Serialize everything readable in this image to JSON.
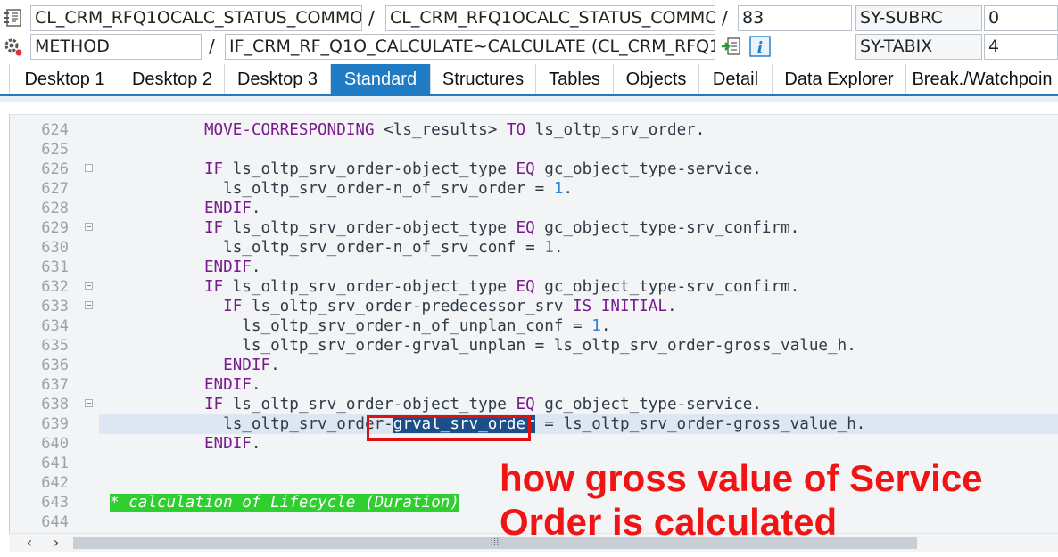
{
  "header": {
    "row1": {
      "program": "CL_CRM_RFQ1OCALC_STATUS_COMMO…",
      "include": "CL_CRM_RFQ1OCALC_STATUS_COMMO…",
      "line": "83",
      "sysfield_name": "SY-SUBRC",
      "sysfield_value": "0"
    },
    "row2": {
      "event_type": "METHOD",
      "event_name": "IF_CRM_RF_Q1O_CALCULATE~CALCULATE (CL_CRM_RFQ1…",
      "sysfield_name": "SY-TABIX",
      "sysfield_value": "4"
    },
    "separator": "/",
    "icons": [
      "source-code-icon",
      "settings-gear-icon",
      "navigate-icon",
      "info-icon"
    ]
  },
  "tabs": [
    {
      "label": "Desktop 1",
      "active": false
    },
    {
      "label": "Desktop 2",
      "active": false
    },
    {
      "label": "Desktop 3",
      "active": false
    },
    {
      "label": "Standard",
      "active": true
    },
    {
      "label": "Structures",
      "active": false
    },
    {
      "label": "Tables",
      "active": false
    },
    {
      "label": "Objects",
      "active": false
    },
    {
      "label": "Detail",
      "active": false
    },
    {
      "label": "Data Explorer",
      "active": false
    },
    {
      "label": "Break./Watchpoin",
      "active": false
    }
  ],
  "editor": {
    "current_line": "639",
    "lines": [
      {
        "num": "624",
        "fold": false,
        "parts": [
          [
            "",
            "          "
          ],
          [
            "kw",
            "MOVE-CORRESPONDING"
          ],
          [
            "",
            " <ls_results> "
          ],
          [
            "kw",
            "TO"
          ],
          [
            "",
            " ls_oltp_srv_order."
          ]
        ]
      },
      {
        "num": "625",
        "fold": false,
        "parts": []
      },
      {
        "num": "626",
        "fold": true,
        "parts": [
          [
            "",
            "          "
          ],
          [
            "kw",
            "IF"
          ],
          [
            "",
            " ls_oltp_srv_order-object_type "
          ],
          [
            "kw",
            "EQ"
          ],
          [
            "",
            " gc_object_type-service."
          ]
        ]
      },
      {
        "num": "627",
        "fold": false,
        "parts": [
          [
            "",
            "            ls_oltp_srv_order-n_of_srv_order = "
          ],
          [
            "num",
            "1"
          ],
          [
            "",
            "."
          ]
        ]
      },
      {
        "num": "628",
        "fold": false,
        "parts": [
          [
            "",
            "          "
          ],
          [
            "kw",
            "ENDIF"
          ],
          [
            "",
            "."
          ]
        ]
      },
      {
        "num": "629",
        "fold": true,
        "parts": [
          [
            "",
            "          "
          ],
          [
            "kw",
            "IF"
          ],
          [
            "",
            " ls_oltp_srv_order-object_type "
          ],
          [
            "kw",
            "EQ"
          ],
          [
            "",
            " gc_object_type-srv_confirm."
          ]
        ]
      },
      {
        "num": "630",
        "fold": false,
        "parts": [
          [
            "",
            "            ls_oltp_srv_order-n_of_srv_conf = "
          ],
          [
            "num",
            "1"
          ],
          [
            "",
            "."
          ]
        ]
      },
      {
        "num": "631",
        "fold": false,
        "parts": [
          [
            "",
            "          "
          ],
          [
            "kw",
            "ENDIF"
          ],
          [
            "",
            "."
          ]
        ]
      },
      {
        "num": "632",
        "fold": true,
        "parts": [
          [
            "",
            "          "
          ],
          [
            "kw",
            "IF"
          ],
          [
            "",
            " ls_oltp_srv_order-object_type "
          ],
          [
            "kw",
            "EQ"
          ],
          [
            "",
            " gc_object_type-srv_confirm."
          ]
        ]
      },
      {
        "num": "633",
        "fold": true,
        "parts": [
          [
            "",
            "            "
          ],
          [
            "kw",
            "IF"
          ],
          [
            "",
            " ls_oltp_srv_order-predecessor_srv "
          ],
          [
            "kw",
            "IS INITIAL"
          ],
          [
            "",
            "."
          ]
        ]
      },
      {
        "num": "634",
        "fold": false,
        "parts": [
          [
            "",
            "              ls_oltp_srv_order-n_of_unplan_conf = "
          ],
          [
            "num",
            "1"
          ],
          [
            "",
            "."
          ]
        ]
      },
      {
        "num": "635",
        "fold": false,
        "parts": [
          [
            "",
            "              ls_oltp_srv_order-grval_unplan = ls_oltp_srv_order-gross_value_h."
          ]
        ]
      },
      {
        "num": "636",
        "fold": false,
        "parts": [
          [
            "",
            "            "
          ],
          [
            "kw",
            "ENDIF"
          ],
          [
            "",
            "."
          ]
        ]
      },
      {
        "num": "637",
        "fold": false,
        "parts": [
          [
            "",
            "          "
          ],
          [
            "kw",
            "ENDIF"
          ],
          [
            "",
            "."
          ]
        ]
      },
      {
        "num": "638",
        "fold": true,
        "parts": [
          [
            "",
            "          "
          ],
          [
            "kw",
            "IF"
          ],
          [
            "",
            " ls_oltp_srv_order-object_type "
          ],
          [
            "kw",
            "EQ"
          ],
          [
            "",
            " gc_object_type-service."
          ]
        ]
      },
      {
        "num": "639",
        "fold": false,
        "parts": [
          [
            "",
            "            ls_oltp_srv_order-"
          ],
          [
            "sel",
            "grval_srv_order"
          ],
          [
            "",
            " = ls_oltp_srv_order-gross_value_h."
          ]
        ]
      },
      {
        "num": "640",
        "fold": false,
        "parts": [
          [
            "",
            "          "
          ],
          [
            "kw",
            "ENDIF"
          ],
          [
            "",
            "."
          ]
        ]
      },
      {
        "num": "641",
        "fold": false,
        "parts": []
      },
      {
        "num": "642",
        "fold": false,
        "parts": []
      },
      {
        "num": "643",
        "fold": false,
        "parts": [
          [
            "cmt",
            "* calculation of Lifecycle (Duration)"
          ]
        ]
      },
      {
        "num": "644",
        "fold": false,
        "parts": []
      }
    ]
  },
  "scrollbar": {
    "left": "‹",
    "right": "›",
    "grip": "⦙⦙⦙"
  },
  "annotation": {
    "line1": "how gross value of Service",
    "line2": "Order is calculated"
  },
  "colors": {
    "tab_active": "#1e7bc4",
    "keyword": "#7a1a8f",
    "number": "#2e7fd6",
    "annotation": "#f01414",
    "comment_bg": "#2fcf2f",
    "selection_bg": "#1b4f8a"
  }
}
